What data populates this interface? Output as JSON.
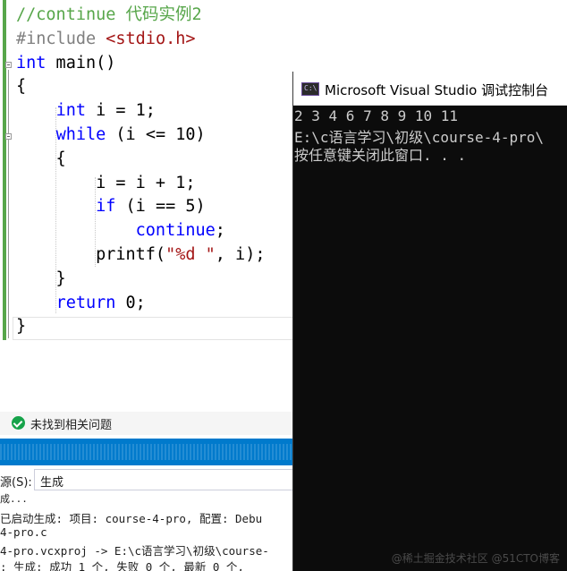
{
  "editor": {
    "lines": [
      [
        {
          "t": "//continue 代码实例2",
          "c": "c-comment"
        }
      ],
      [
        {
          "t": "#include ",
          "c": "c-pre"
        },
        {
          "t": "<stdio.h>",
          "c": "c-inc"
        }
      ],
      [
        {
          "t": "int",
          "c": "c-kw"
        },
        {
          "t": " main()",
          "c": "c-op"
        }
      ],
      [
        {
          "t": "{",
          "c": "c-op"
        }
      ],
      [
        {
          "t": "    ",
          "c": "c-op"
        },
        {
          "t": "int",
          "c": "c-kw"
        },
        {
          "t": " i = 1;",
          "c": "c-op"
        }
      ],
      [
        {
          "t": "    ",
          "c": "c-op"
        },
        {
          "t": "while",
          "c": "c-kw"
        },
        {
          "t": " (i <= 10)",
          "c": "c-op"
        }
      ],
      [
        {
          "t": "    {",
          "c": "c-op"
        }
      ],
      [
        {
          "t": "        i = i + 1;",
          "c": "c-op"
        }
      ],
      [
        {
          "t": "        ",
          "c": "c-op"
        },
        {
          "t": "if",
          "c": "c-kw"
        },
        {
          "t": " (i == 5)",
          "c": "c-op"
        }
      ],
      [
        {
          "t": "            ",
          "c": "c-op"
        },
        {
          "t": "continue",
          "c": "c-kw"
        },
        {
          "t": ";",
          "c": "c-op"
        }
      ],
      [
        {
          "t": "        printf(",
          "c": "c-op"
        },
        {
          "t": "\"%d \"",
          "c": "c-str"
        },
        {
          "t": ", i);",
          "c": "c-op"
        }
      ],
      [
        {
          "t": "    }",
          "c": "c-op"
        }
      ],
      [
        {
          "t": "    ",
          "c": "c-op"
        },
        {
          "t": "return",
          "c": "c-kw"
        },
        {
          "t": " 0;",
          "c": "c-op"
        }
      ],
      [
        {
          "t": "}",
          "c": "c-op"
        }
      ]
    ]
  },
  "status": {
    "issues_text": "未找到相关问题"
  },
  "output": {
    "source_label": "源(S):",
    "source_value": "生成",
    "lines": [
      "已启动生成: 项目: course-4-pro, 配置: Debu",
      "4-pro.c",
      "4-pro.vcxproj -> E:\\c语言学习\\初级\\course-",
      ": 生成: 成功 1 个, 失败 0 个, 最新 0 个,"
    ],
    "partial_top": "成..."
  },
  "console": {
    "title": "Microsoft Visual Studio 调试控制台",
    "icon_text": "C:\\",
    "lines": [
      "2 3 4 6 7 8 9 10 11",
      "E:\\c语言学习\\初级\\course-4-pro\\",
      "按任意键关闭此窗口. . ."
    ],
    "watermark": "@稀土掘金技术社区 @51CTO博客"
  }
}
